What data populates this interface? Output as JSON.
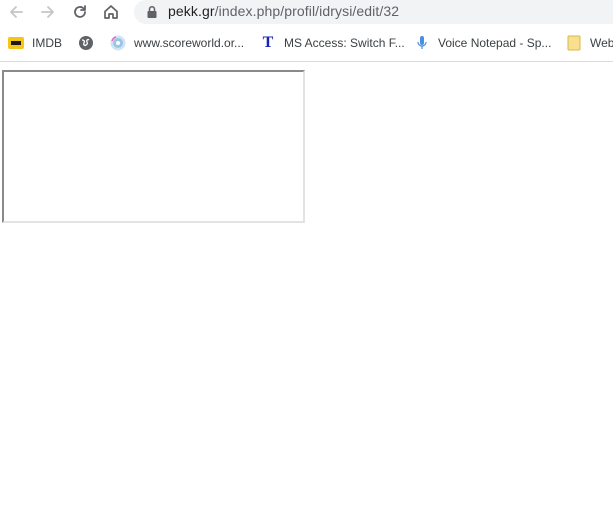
{
  "browser": {
    "url_host": "pekk.gr",
    "url_path": "/index.php/profil/idrysi/edit/32",
    "nav": {
      "back_icon": "back-arrow-icon",
      "forward_icon": "forward-arrow-icon",
      "reload_icon": "reload-icon",
      "home_icon": "home-icon",
      "lock_icon": "lock-icon"
    }
  },
  "bookmarks": [
    {
      "label": "IMDB",
      "icon": "imdb-icon"
    },
    {
      "label": "",
      "icon": "globe-icon"
    },
    {
      "label": "www.scoreworld.or...",
      "icon": "disc-icon"
    },
    {
      "label": "MS Access: Switch F...",
      "icon": "t-letter-icon"
    },
    {
      "label": "Voice Notepad - Sp...",
      "icon": "microphone-icon"
    },
    {
      "label": "Web",
      "icon": "folder-icon"
    }
  ],
  "colors": {
    "omnibox_bg": "#f1f3f4",
    "imdb_yellow": "#f5c518",
    "t_icon_blue": "#1a23b8",
    "folder_yellow": "#f8e08e"
  }
}
